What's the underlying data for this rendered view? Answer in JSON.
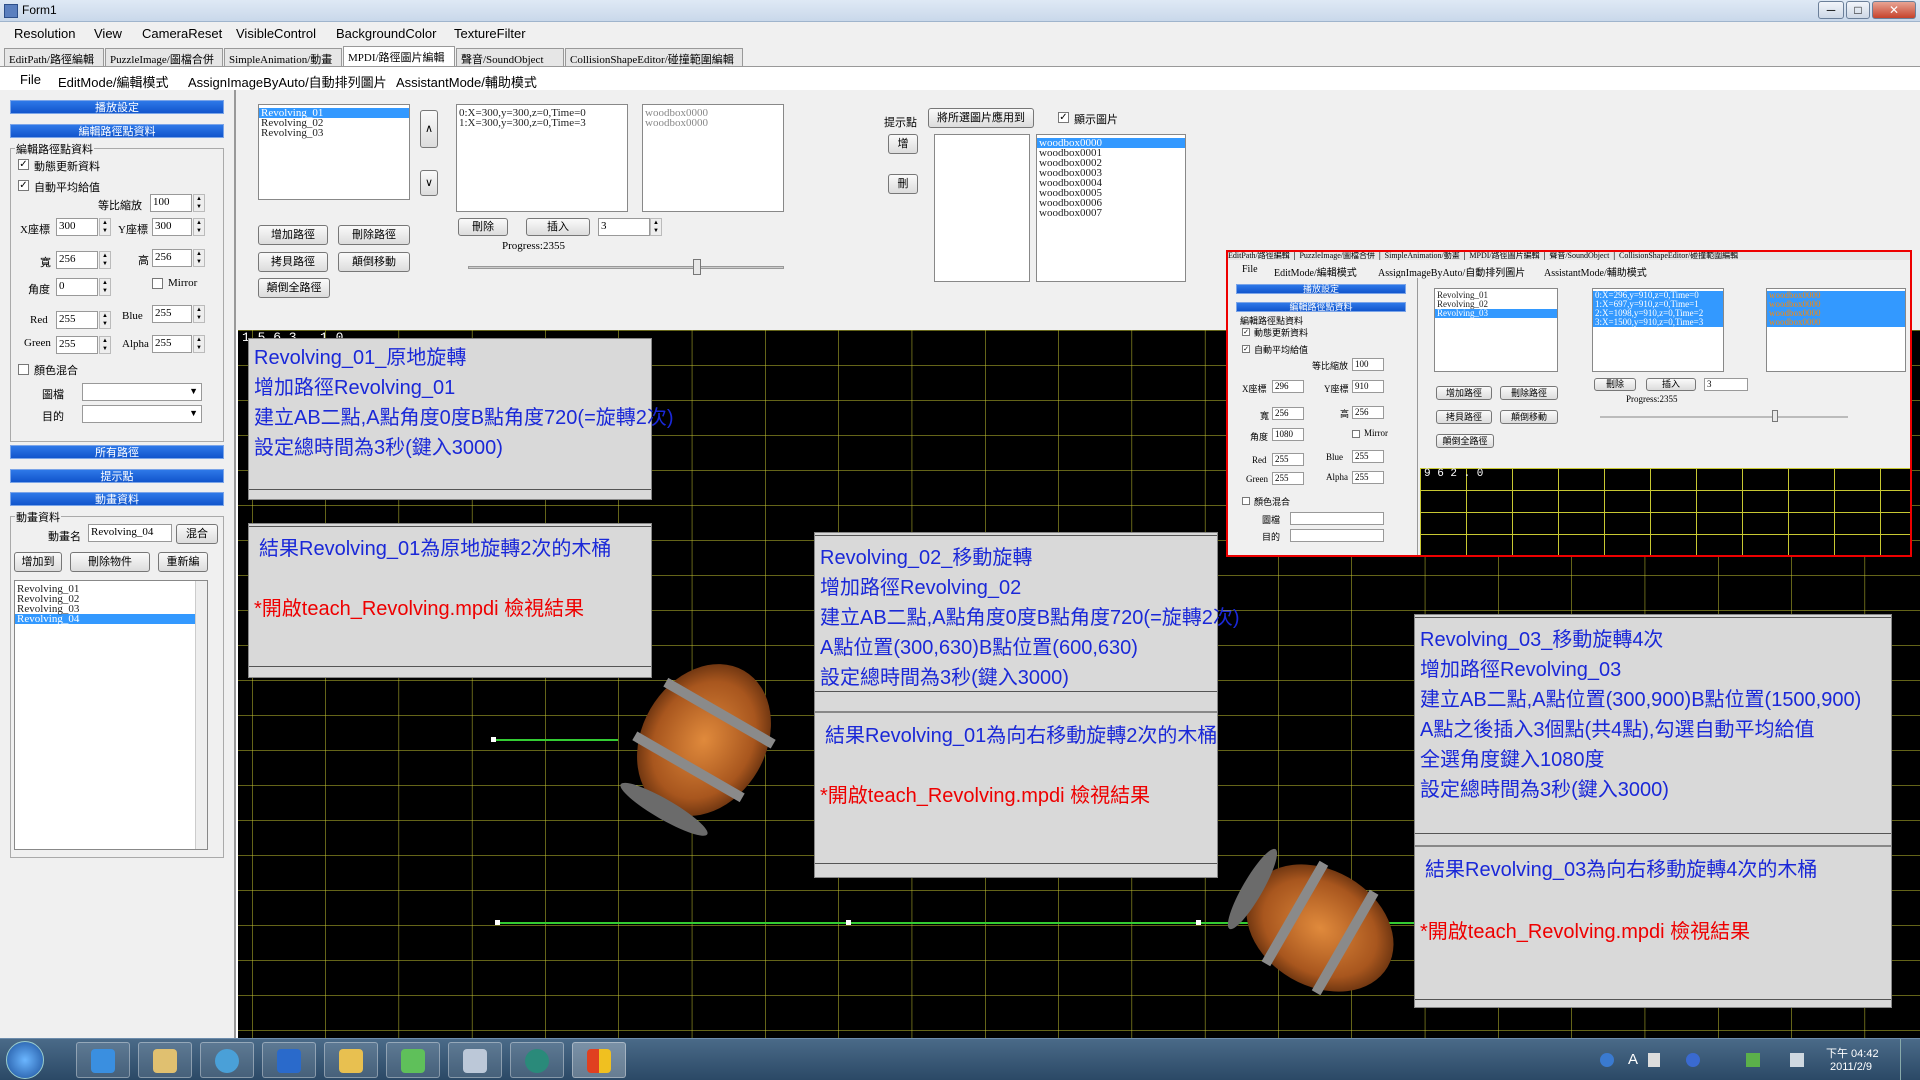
{
  "window": {
    "title": "Form1",
    "minimize": "─",
    "maximize": "□",
    "close": "✕"
  },
  "menubar": [
    "Resolution",
    "View",
    "CameraReset",
    "VisibleControl",
    "BackgroundColor",
    "TextureFilter"
  ],
  "tabs": [
    "EditPath/路徑編輯",
    "PuzzleImage/圖檔合併",
    "SimpleAnimation/動畫",
    "MPDI/路徑圖片編輯",
    "聲音/SoundObject",
    "CollisionShapeEditor/碰撞範圍編輯"
  ],
  "submenu": [
    "File",
    "EditMode/編輯模式",
    "AssignImageByAuto/自動排列圖片",
    "AssistantMode/輔助模式"
  ],
  "left": {
    "play_settings": "播放設定",
    "edit_path_data": "編輯路徑點資料",
    "group_title": "編輯路徑點資料",
    "dynamic_update": "動態更新資料",
    "auto_average": "自動平均給值",
    "scale_label": "等比縮放",
    "scale": "100",
    "x_label": "X座標",
    "x": "300",
    "y_label": "Y座標",
    "y": "300",
    "width_label": "寬",
    "width": "256",
    "height_label": "高",
    "height": "256",
    "angle_label": "角度",
    "angle": "0",
    "mirror": "Mirror",
    "red_label": "Red",
    "red": "255",
    "blue_label": "Blue",
    "blue": "255",
    "green_label": "Green",
    "green": "255",
    "alpha_label": "Alpha",
    "alpha": "255",
    "color_blend": "顏色混合",
    "image_label": "圖檔",
    "target_label": "目的",
    "all_paths": "所有路徑",
    "hint_points": "提示點",
    "anim_data": "動畫資料",
    "anim_group": "動畫資料",
    "anim_name_label": "動畫名",
    "anim_name": "Revolving_04",
    "blend_btn": "混合",
    "add_to": "增加到",
    "delete_obj": "刪除物件",
    "reedit": "重新編",
    "anim_list": [
      "Revolving_01",
      "Revolving_02",
      "Revolving_03",
      "Revolving_04"
    ]
  },
  "top": {
    "paths": [
      "Revolving_01",
      "Revolving_02",
      "Revolving_03"
    ],
    "up": "∧",
    "down": "∨",
    "points": [
      "0:X=300,y=300,z=0,Time=0",
      "1:X=300,y=300,z=0,Time=3"
    ],
    "images": [
      "woodbox0000",
      "woodbox0000"
    ],
    "add_path": "增加路徑",
    "del_path": "刪除路徑",
    "copy_path": "拷貝路徑",
    "reverse_move": "顛倒移動",
    "reverse_all": "顛倒全路徑",
    "delete": "刪除",
    "insert": "插入",
    "insert_count": "3",
    "progress": "Progress:2355",
    "progress_value": 0.72,
    "hint_label": "提示點",
    "hint_add": "增",
    "hint_del": "刪",
    "apply_btn": "將所選圖片應用到",
    "show_image": "顯示圖片",
    "woodbox_list": [
      "woodbox0000",
      "woodbox0001",
      "woodbox0002",
      "woodbox0003",
      "woodbox0004",
      "woodbox0005",
      "woodbox0006",
      "woodbox0007"
    ]
  },
  "canvas": {
    "coord": "1 5 6 3 , 1 0",
    "note1": {
      "lines": [
        "Revolving_01_原地旋轉",
        "增加路徑Revolving_01",
        "建立AB二點,A點角度0度B點角度720(=旋轉2次)",
        "設定總時間為3秒(鍵入3000)"
      ]
    },
    "note1b": {
      "result": "結果Revolving_01為原地旋轉2次的木桶",
      "open": "*開啟teach_Revolving.mpdi 檢視結果"
    },
    "note2": {
      "lines": [
        "Revolving_02_移動旋轉",
        "增加路徑Revolving_02",
        "建立AB二點,A點角度0度B點角度720(=旋轉2次)",
        "A點位置(300,630)B點位置(600,630)",
        "設定總時間為3秒(鍵入3000)"
      ]
    },
    "note2b": {
      "result": "結果Revolving_01為向右移動旋轉2次的木桶",
      "open": "*開啟teach_Revolving.mpdi 檢視結果"
    },
    "note3": {
      "lines": [
        "Revolving_03_移動旋轉4次",
        "增加路徑Revolving_03",
        "建立AB二點,A點位置(300,900)B點位置(1500,900)",
        "A點之後插入3個點(共4點),勾選自動平均給值",
        "全選角度鍵入1080度",
        "設定總時間為3秒(鍵入3000)"
      ]
    },
    "note3b": {
      "result": "結果Revolving_03為向右移動旋轉4次的木桶",
      "open": "*開啟teach_Revolving.mpdi 檢視結果"
    }
  },
  "inset": {
    "tabs": "EditPath/路徑編輯 │ PuzzleImage/圖檔合併 │ SimpleAnimation/動畫 │ MPDI/路徑圖片編輯 │ 聲音/SoundObject │ CollisionShapeEditor/碰撞範圍編輯",
    "submenu": [
      "File",
      "EditMode/編輯模式",
      "AssignImageByAuto/自動排列圖片",
      "AssistantMode/輔助模式"
    ],
    "play": "播放設定",
    "edit_data": "編輯路徑點資料",
    "group": "編輯路徑點資料",
    "dyn": "動態更新資料",
    "avg": "自動平均給值",
    "scale_label": "等比縮放",
    "scale": "100",
    "x_label": "X座標",
    "x": "296",
    "y_label": "Y座標",
    "y": "910",
    "w_label": "寬",
    "w": "256",
    "h_label": "高",
    "h": "256",
    "ang_label": "角度",
    "ang": "1080",
    "mirror": "Mirror",
    "red_label": "Red",
    "red": "255",
    "blue_label": "Blue",
    "blue": "255",
    "green_label": "Green",
    "green": "255",
    "alpha_label": "Alpha",
    "alpha": "255",
    "blend": "顏色混合",
    "img_label": "圖檔",
    "tgt_label": "目的",
    "paths": [
      "Revolving_01",
      "Revolving_02",
      "Revolving_03"
    ],
    "points": [
      "0:X=296,y=910,z=0,Time=0",
      "1:X=697,y=910,z=0,Time=1",
      "2:X=1098,y=910,z=0,Time=2",
      "3:X=1500,y=910,z=0,Time=3"
    ],
    "images": [
      "woodbox0000",
      "woodbox0000",
      "woodbox0000",
      "woodbox0000"
    ],
    "add_path": "增加路徑",
    "del_path": "刪除路徑",
    "copy_path": "拷貝路徑",
    "rev_move": "顛倒移動",
    "rev_all": "顛倒全路徑",
    "delete": "刪除",
    "insert": "插入",
    "insert_count": "3",
    "progress": "Progress:2355",
    "coord": "9 6 2 . 0"
  },
  "taskbar": {
    "time": "下午 04:42",
    "date": "2011/2/9",
    "lang": "A"
  },
  "colors": {
    "canvas_bg": "#000000",
    "grid": "#c8c832",
    "path": "#33cc33",
    "note_text": "#1a28d8",
    "note_red": "#e00000",
    "inset_border": "#e00000",
    "selection": "#3399ff"
  }
}
